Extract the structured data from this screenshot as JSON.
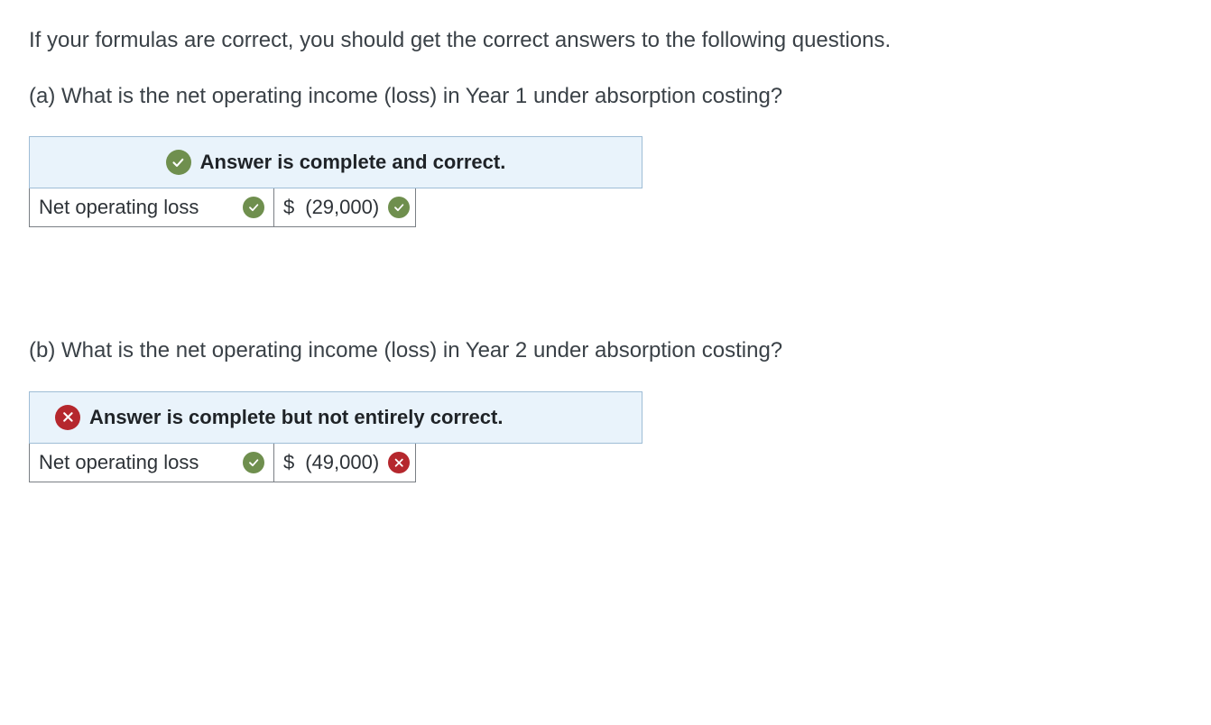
{
  "intro": "If your formulas are correct, you should get the correct answers to the following questions.",
  "question_a": {
    "text": "(a) What is the net operating income (loss) in Year 1 under absorption costing?",
    "banner": "Answer is complete and correct.",
    "label": "Net operating loss",
    "currency": "$",
    "value": "(29,000)"
  },
  "question_b": {
    "text": "(b) What is the net operating income (loss) in Year 2 under absorption costing?",
    "banner": "Answer is complete but not entirely correct.",
    "label": "Net operating loss",
    "currency": "$",
    "value": "(49,000)"
  }
}
